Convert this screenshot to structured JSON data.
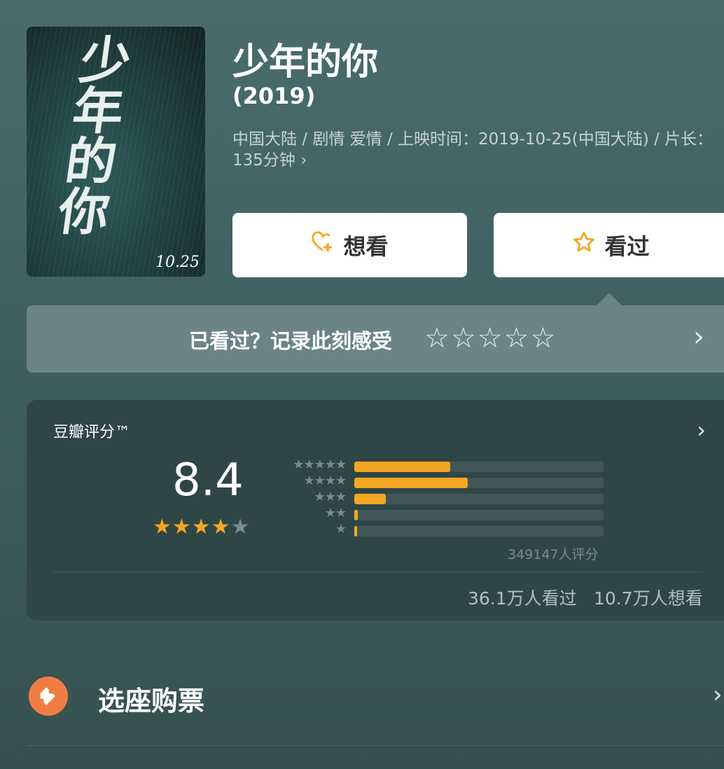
{
  "movie": {
    "title": "少年的你",
    "year": "(2019)",
    "meta": "中国大陆 / 剧情 爱情 / 上映时间：2019-10-25(中国大陆) / 片长：135分钟 ",
    "meta_chevron": "›",
    "poster": {
      "title_glyphs": "少年的你",
      "date": "10.25"
    }
  },
  "actions": {
    "want_label": "想看",
    "seen_label": "看过"
  },
  "record": {
    "prompt": "已看过？记录此刻感受",
    "stars": "☆☆☆☆☆",
    "chevron": "›"
  },
  "douban": {
    "label": "豆瓣评分™",
    "score": "8.4",
    "stars_on": "★★★★",
    "stars_off": "★",
    "distribution": [
      {
        "label": "★★★★★",
        "percent": 38.5
      },
      {
        "label": "★★★★",
        "percent": 45.5
      },
      {
        "label": "★★★",
        "percent": 12.5
      },
      {
        "label": "★★",
        "percent": 1.5
      },
      {
        "label": "★",
        "percent": 1.0
      }
    ],
    "rating_count": "349147人评分",
    "seen_count": "36.1万人看过",
    "wish_count": "10.7万人想看",
    "chevron": "›"
  },
  "ticket": {
    "label": "选座购票",
    "chevron": "›"
  },
  "colors": {
    "accent": "#f5a623",
    "ticket_icon": "#f07c44"
  }
}
